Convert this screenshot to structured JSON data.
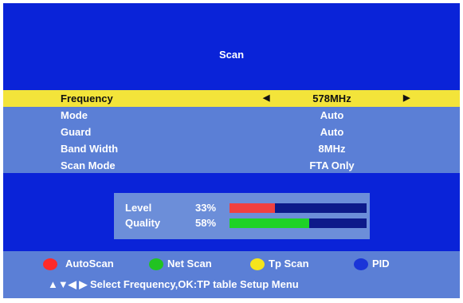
{
  "screen": {
    "title": "Scan"
  },
  "menu": {
    "items": [
      {
        "label": "Frequency",
        "value": "578MHz"
      },
      {
        "label": "Mode",
        "value": "Auto"
      },
      {
        "label": "Guard",
        "value": "Auto"
      },
      {
        "label": "Band Width",
        "value": "8MHz"
      },
      {
        "label": "Scan Mode",
        "value": "FTA Only"
      }
    ],
    "left_arrow": "◀",
    "right_arrow": "▶"
  },
  "signal": {
    "level": {
      "label": "Level",
      "percent_text": "33%",
      "value": 0.33,
      "color": "#f04040"
    },
    "quality": {
      "label": "Quality",
      "percent_text": "58%",
      "value": 0.58,
      "color": "#1fd226"
    }
  },
  "legend": [
    {
      "label": "AutoScan",
      "color": "#ff2a2a",
      "icon": "red-button-icon"
    },
    {
      "label": "Net Scan",
      "color": "#21c321",
      "icon": "green-button-icon"
    },
    {
      "label": "Tp Scan",
      "color": "#f5e51c",
      "icon": "yellow-button-icon"
    },
    {
      "label": "PID",
      "color": "#1a35d8",
      "icon": "blue-button-icon"
    }
  ],
  "help": {
    "arrows": "▲▼◀ ▶",
    "text": "Select Frequency,OK:TP table Setup Menu"
  },
  "colors": {
    "background": "#0a23d8",
    "panel": "#5b7fd6",
    "highlight": "#f3e43a"
  }
}
